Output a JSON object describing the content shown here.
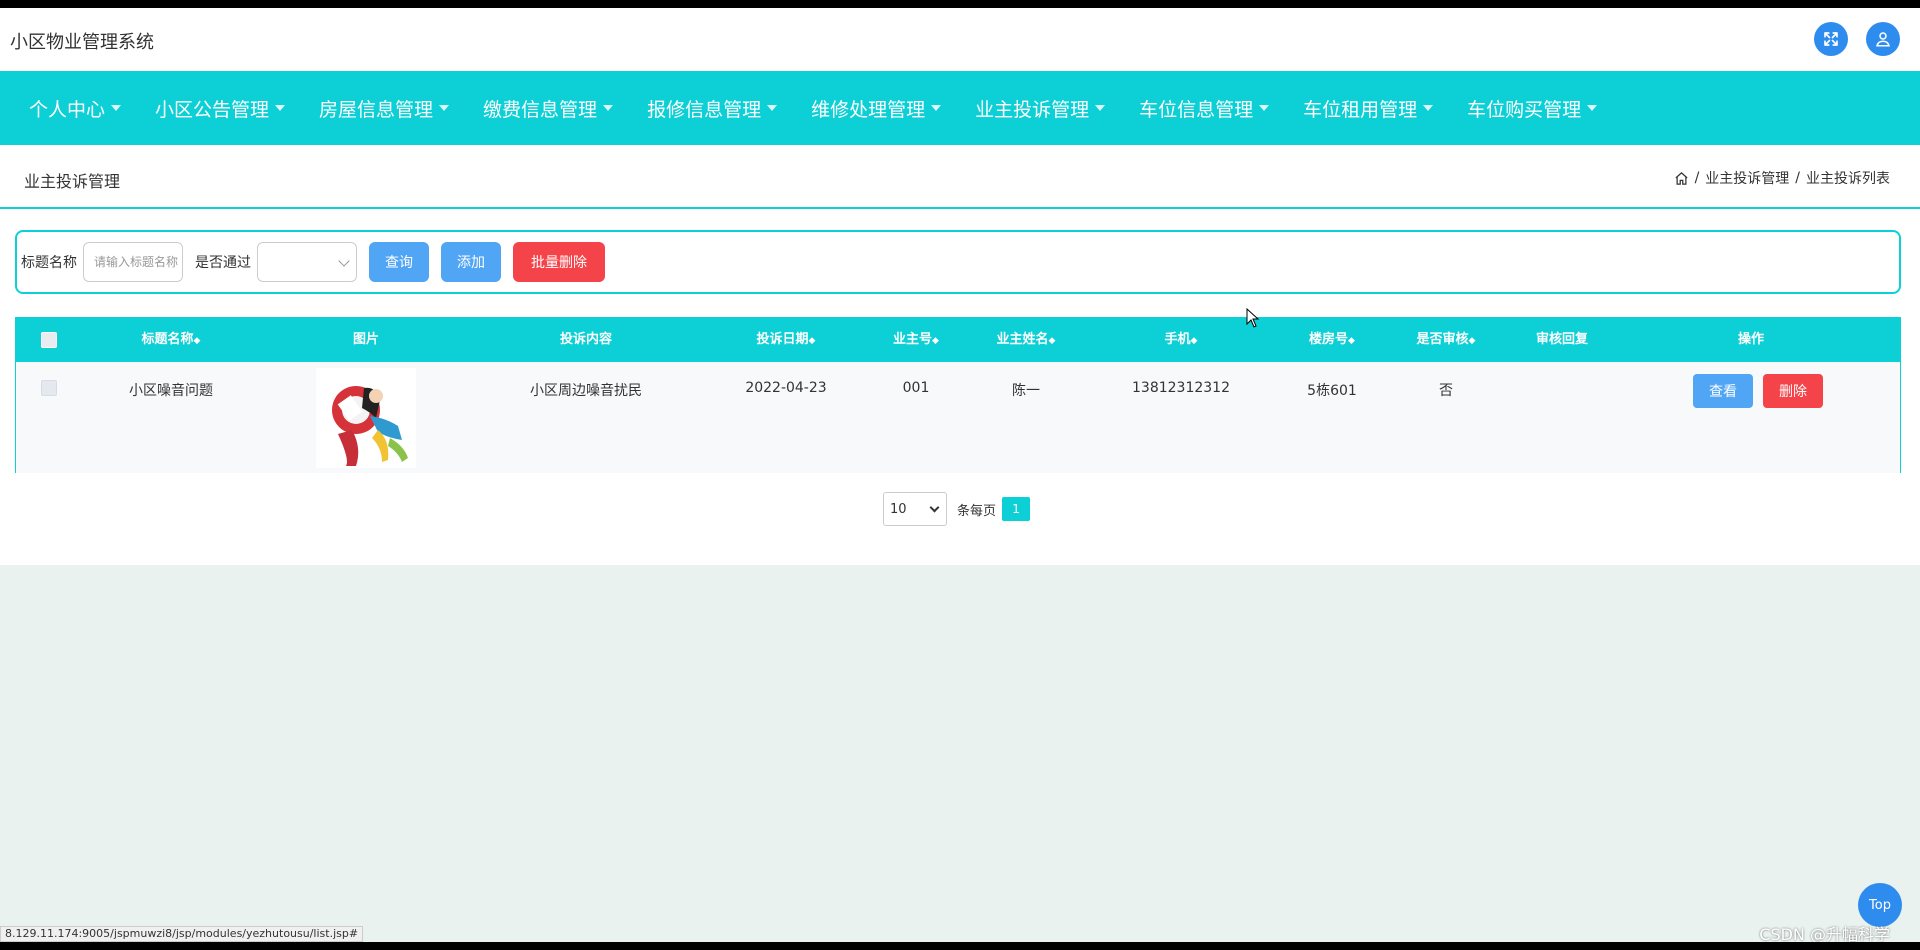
{
  "app": {
    "title": "小区物业管理系统"
  },
  "nav": [
    {
      "label": "个人中心"
    },
    {
      "label": "小区公告管理"
    },
    {
      "label": "房屋信息管理"
    },
    {
      "label": "缴费信息管理"
    },
    {
      "label": "报修信息管理"
    },
    {
      "label": "维修处理管理"
    },
    {
      "label": "业主投诉管理"
    },
    {
      "label": "车位信息管理"
    },
    {
      "label": "车位租用管理"
    },
    {
      "label": "车位购买管理"
    }
  ],
  "page": {
    "title": "业主投诉管理",
    "breadcrumb": [
      "业主投诉管理",
      "业主投诉列表"
    ]
  },
  "search": {
    "title_label": "标题名称",
    "title_placeholder": "请输入标题名称",
    "passed_label": "是否通过",
    "passed_value": "",
    "query_button": "查询",
    "add_button": "添加",
    "batch_delete_button": "批量删除"
  },
  "table": {
    "columns": [
      "标题名称",
      "图片",
      "投诉内容",
      "投诉日期",
      "业主号",
      "业主姓名",
      "手机",
      "楼房号",
      "是否审核",
      "审核回复",
      "操作"
    ],
    "rows": [
      {
        "title": "小区噪音问题",
        "content": "小区周边噪音扰民",
        "date": "2022-04-23",
        "owner_no": "001",
        "owner_name": "陈一",
        "phone": "13812312312",
        "building": "5栋601",
        "reviewed": "否",
        "reply": "",
        "view_button": "查看",
        "delete_button": "删除"
      }
    ]
  },
  "pagination": {
    "page_size": "10",
    "per_page_label": "条每页",
    "current_page": "1"
  },
  "misc": {
    "top_button": "Top",
    "status_url": "8.129.11.174:9005/jspmuwzi8/jsp/modules/yezhutousu/list.jsp#",
    "watermark": "CSDN @升幅科学"
  },
  "colors": {
    "accent": "#0dd0d6",
    "primary_button": "#50a5f5",
    "danger_button": "#f5434a",
    "icon_button": "#2f8cef"
  }
}
